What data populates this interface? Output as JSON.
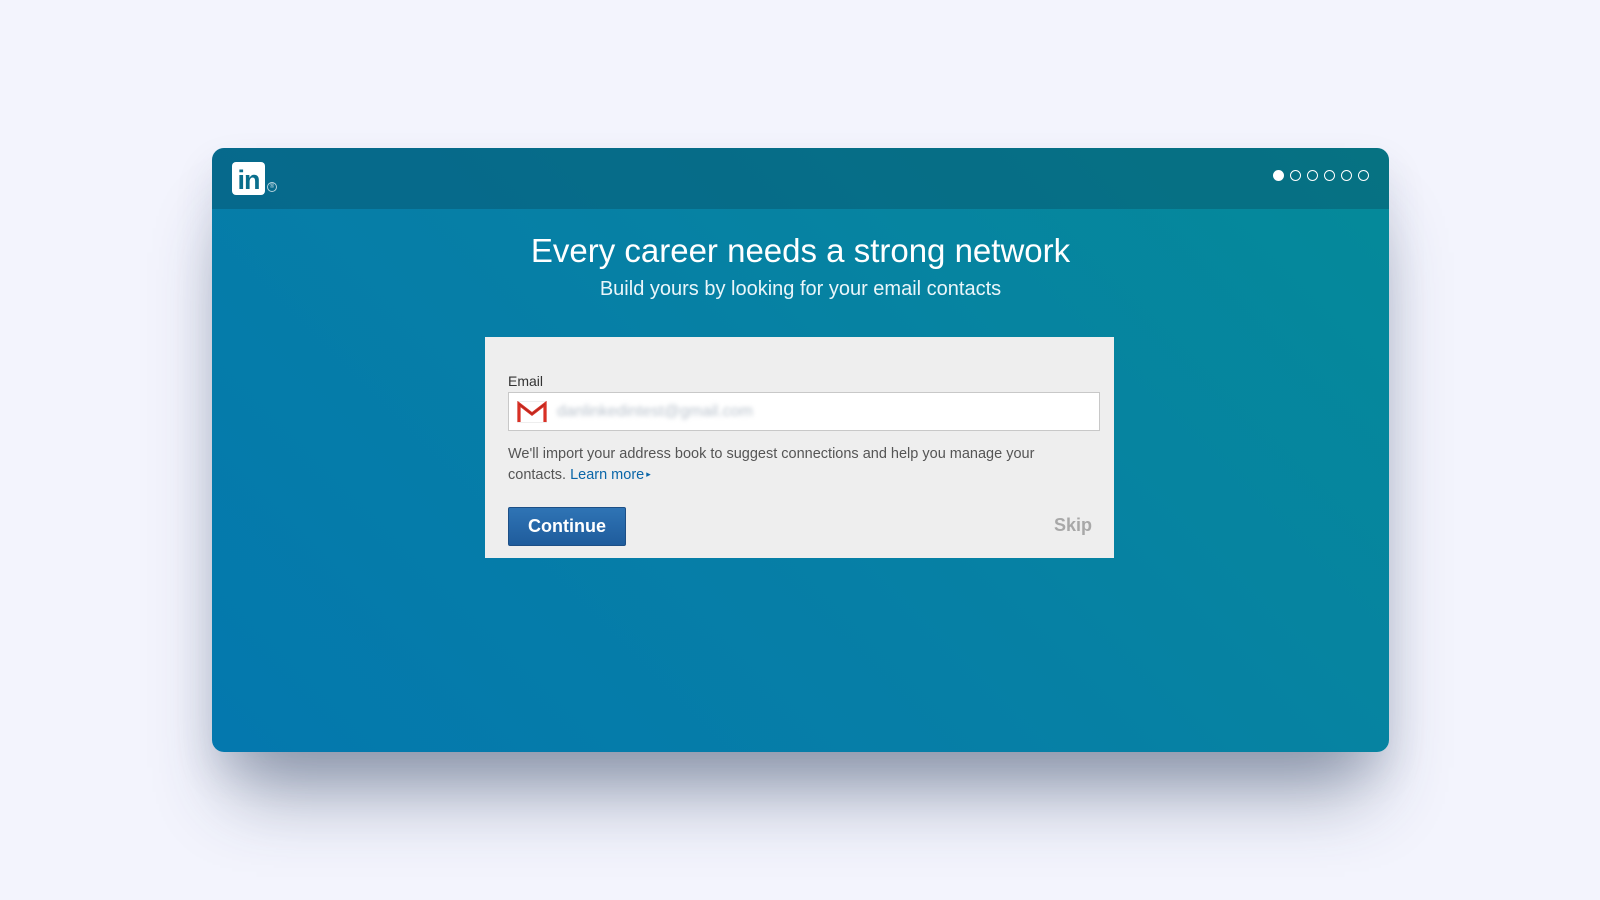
{
  "header": {
    "logo_text": "in",
    "logo_registered_mark": "®",
    "steps": [
      {
        "state": "active"
      },
      {
        "state": "inactive"
      },
      {
        "state": "inactive"
      },
      {
        "state": "inactive"
      },
      {
        "state": "inactive"
      },
      {
        "state": "inactive"
      }
    ],
    "current_step": 1,
    "total_steps": 6
  },
  "main": {
    "title": "Every career needs a strong network",
    "subtitle": "Build yours by looking for your email contacts"
  },
  "form": {
    "email_label": "Email",
    "email_value": "danlinkedintest@gmail.com",
    "email_icon": "gmail-icon",
    "help_text": "We'll import your address book to suggest connections and help you manage your contacts.",
    "learn_more_label": "Learn more",
    "learn_more_caret": "▸",
    "continue_label": "Continue",
    "skip_label": "Skip"
  },
  "colors": {
    "page_background": "#f3f4fd",
    "accent_teal": "#067fa6",
    "button_blue": "#2f74b5",
    "link_blue": "#0a66a8",
    "gmail_red": "#d93025"
  }
}
